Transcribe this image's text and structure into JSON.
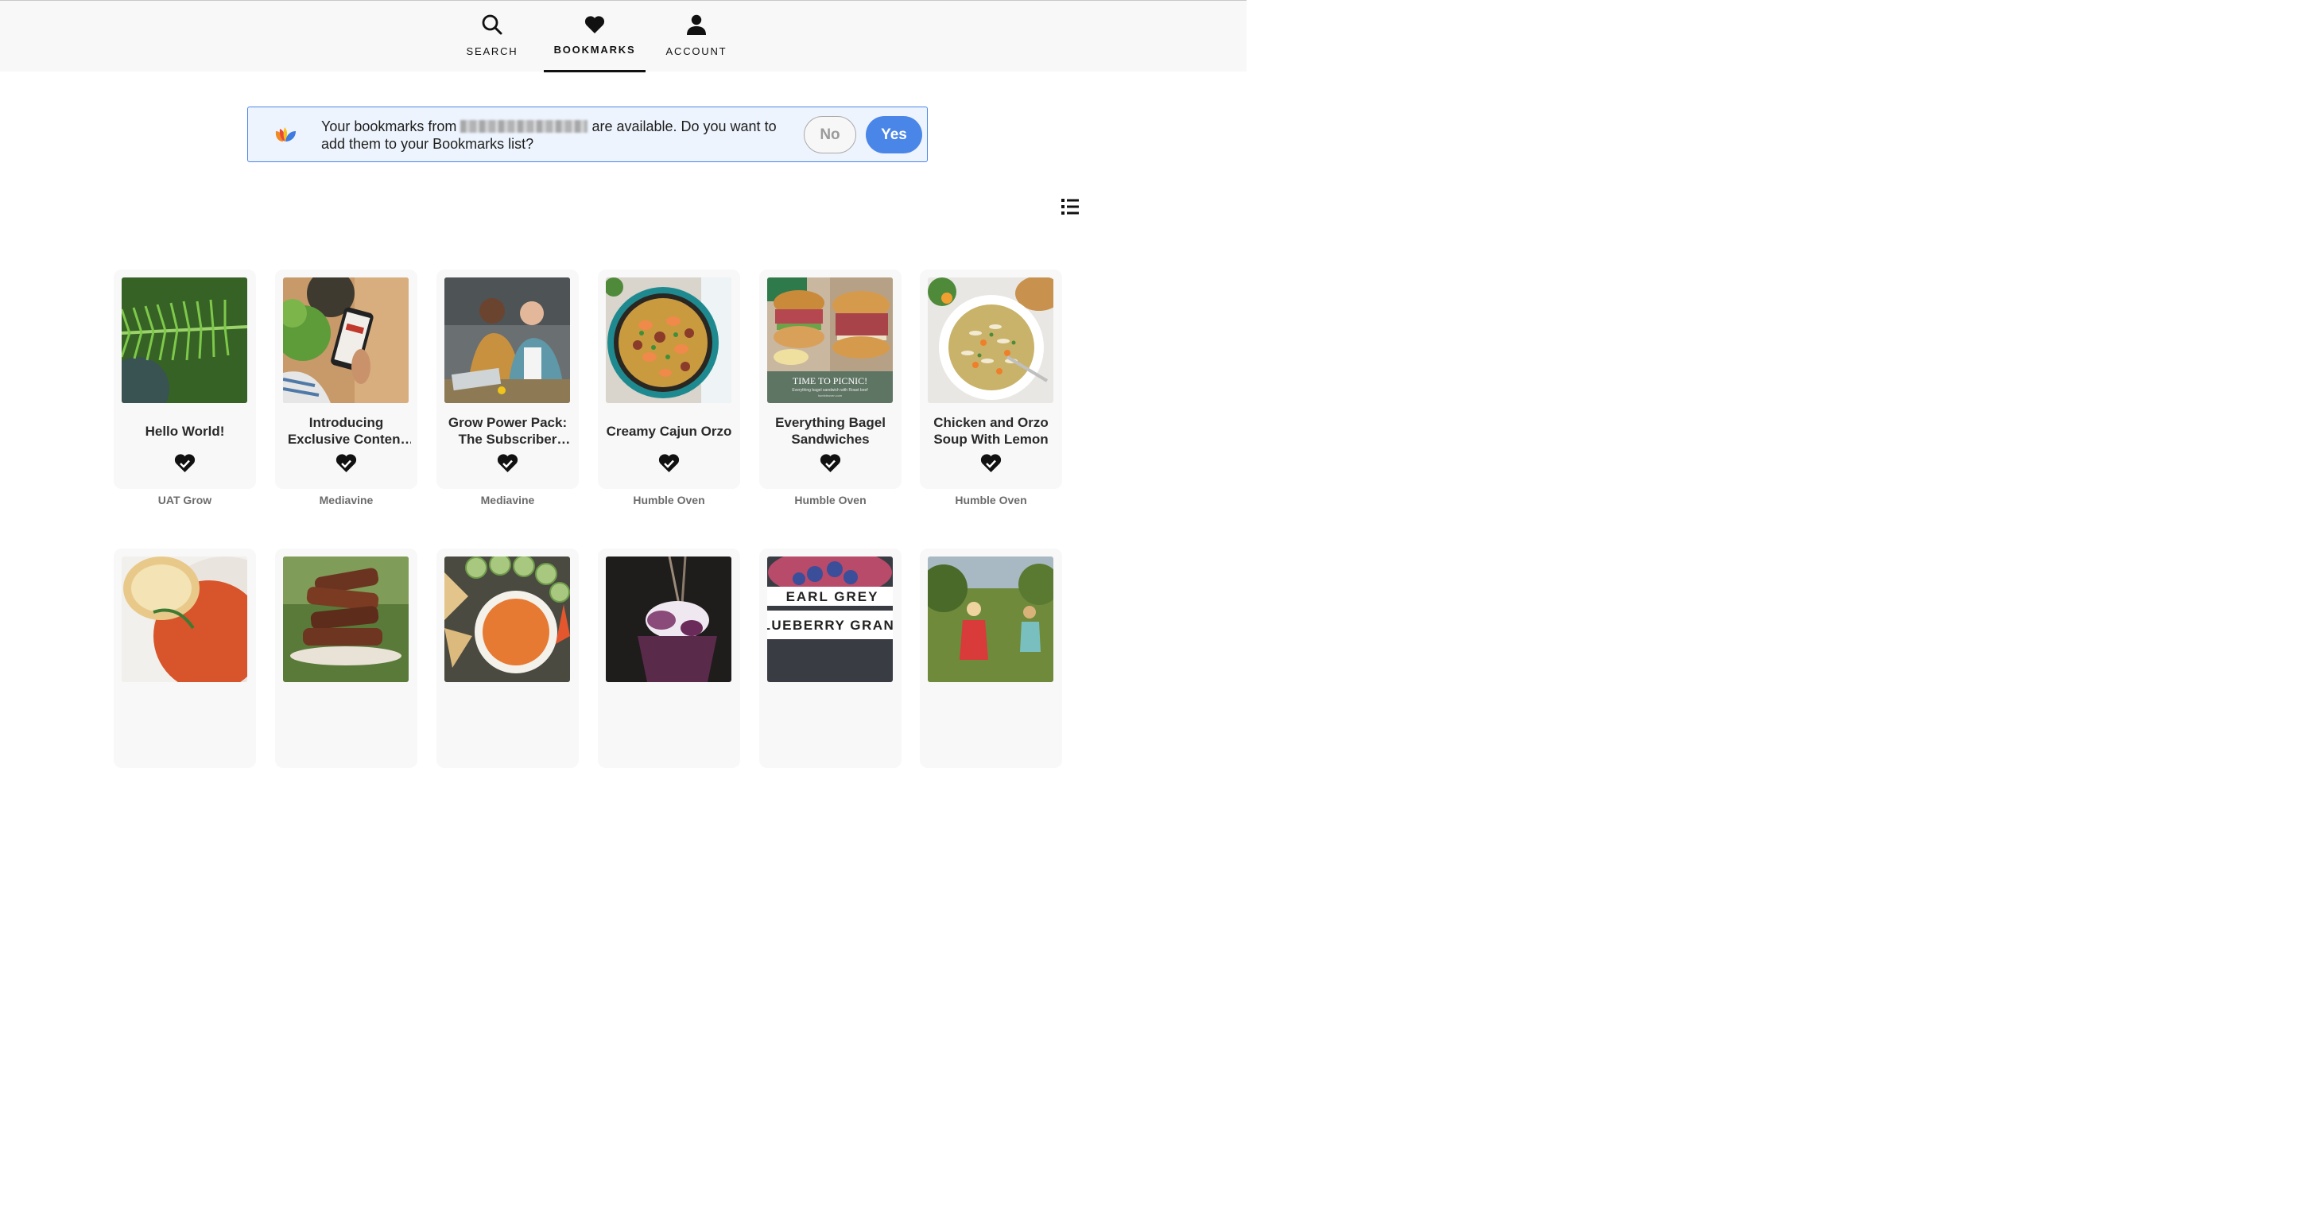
{
  "nav": {
    "tabs": [
      {
        "label": "SEARCH",
        "icon": "search-icon"
      },
      {
        "label": "BOOKMARKS",
        "icon": "heart-icon",
        "active": true
      },
      {
        "label": "ACCOUNT",
        "icon": "person-icon"
      }
    ]
  },
  "banner": {
    "text_before": "Your bookmarks from",
    "text_after": "are available. Do you want to add them to your Bookmarks list?",
    "no_label": "No",
    "yes_label": "Yes",
    "accent": "#4a86e8"
  },
  "cards_row1": [
    {
      "title": "Hello World!",
      "source": "UAT Grow"
    },
    {
      "title": "Introducing Exclusive Content for Subscribers",
      "source": "Mediavine"
    },
    {
      "title": "Grow Power Pack: The Subscriber Experience",
      "source": "Mediavine"
    },
    {
      "title": "Creamy Cajun Orzo",
      "source": "Humble Oven"
    },
    {
      "title": "Everything Bagel Sandwiches",
      "source": "Humble Oven"
    },
    {
      "title": "Chicken and Orzo Soup With Lemon",
      "source": "Humble Oven"
    }
  ],
  "thumb_text": {
    "picnic_title": "TIME TO PICNIC!",
    "picnic_sub": "Everything bagel sandwich with Roast beef",
    "picnic_site": "humbleoven.com",
    "earl_grey_1": "EARL GREY",
    "earl_grey_2": "LUEBERRY GRANI"
  }
}
